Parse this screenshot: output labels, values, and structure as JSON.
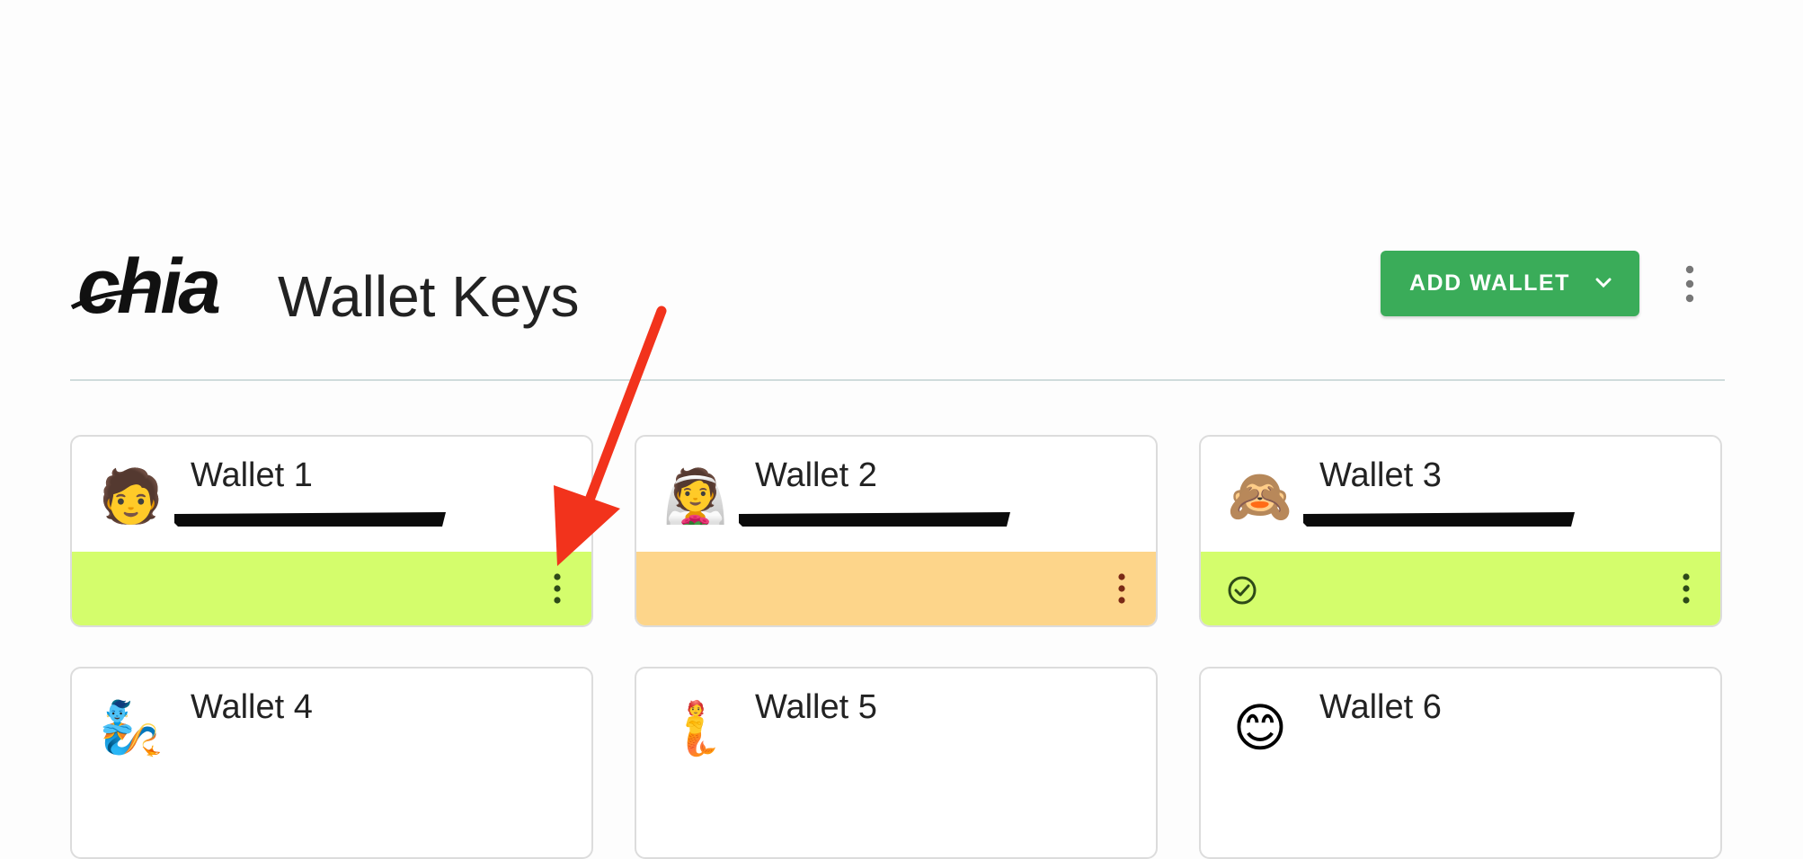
{
  "header": {
    "logo_text": "chia",
    "title": "Wallet Keys",
    "add_wallet_label": "ADD WALLET"
  },
  "colors": {
    "accent_green": "#3aac59",
    "synced_lime": "#d4fd6c",
    "syncing_orange": "#fdd58a"
  },
  "wallets": [
    {
      "name": "Wallet 1",
      "emoji": "🧑",
      "status_color": "#d4fd6c",
      "synced": false,
      "kebab_color": "#2e4a18"
    },
    {
      "name": "Wallet 2",
      "emoji": "👰",
      "status_color": "#fdd58a",
      "synced": false,
      "kebab_color": "#7a2a16"
    },
    {
      "name": "Wallet 3",
      "emoji": "🙈",
      "status_color": "#d4fd6c",
      "synced": true,
      "kebab_color": "#2e4a18"
    },
    {
      "name": "Wallet 4",
      "emoji": "🧞"
    },
    {
      "name": "Wallet 5",
      "emoji": "🧜"
    },
    {
      "name": "Wallet 6",
      "emoji": "😊"
    }
  ],
  "icons": {
    "header_more": "more-vert-icon",
    "dropdown": "chevron-down-icon",
    "card_more": "more-vert-icon",
    "synced": "check-circle-icon",
    "annotation": "red-arrow"
  }
}
